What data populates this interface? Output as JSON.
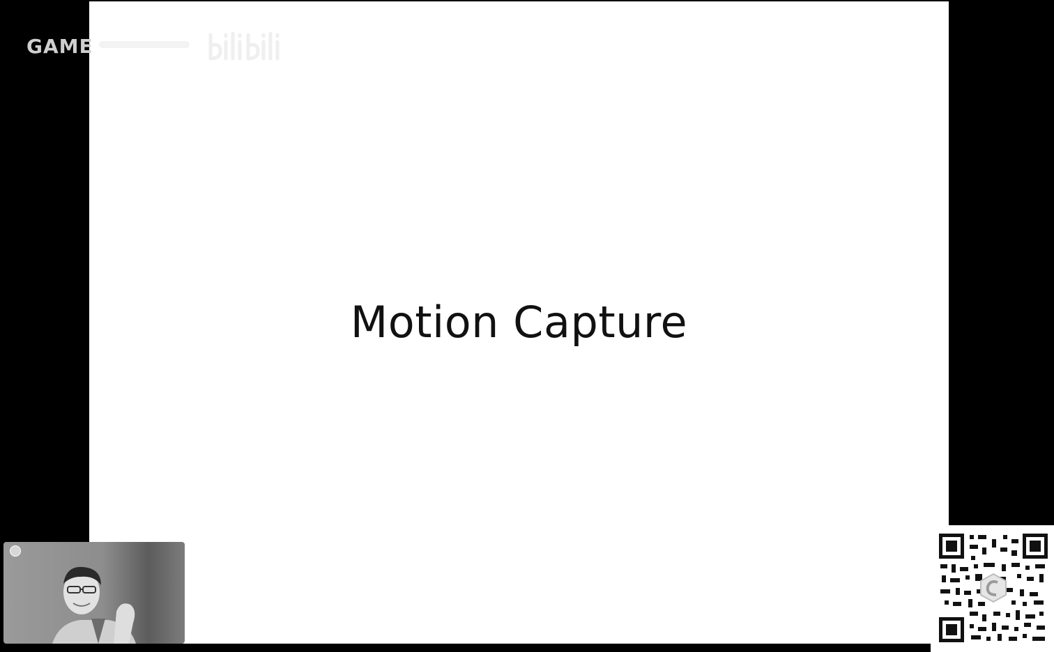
{
  "slide": {
    "title": "Motion Capture"
  },
  "watermark": {
    "text": "GAME",
    "faded_text": "...",
    "logo_icon": "bilibili-logo-icon"
  },
  "webcam": {
    "indicator_icon": "camera-indicator-icon"
  },
  "qr": {
    "icon": "qr-code-icon"
  },
  "colors": {
    "background": "#000000",
    "slide": "#ffffff",
    "title": "#111111",
    "watermark": "#cfcfcf"
  }
}
